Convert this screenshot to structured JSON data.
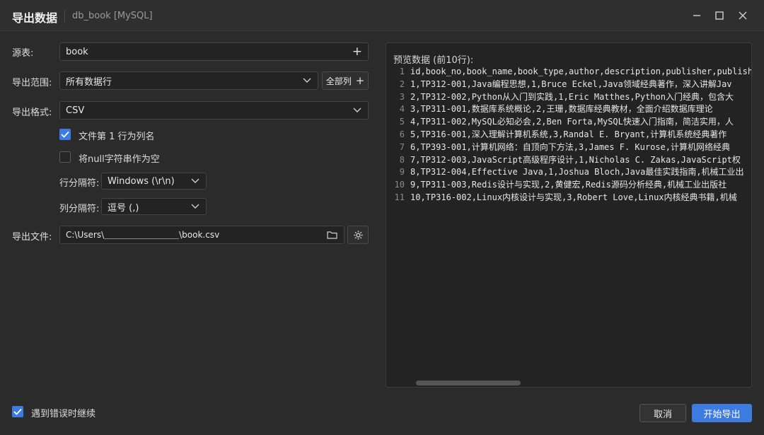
{
  "window": {
    "title": "导出数据",
    "subtitle": "db_book [MySQL]"
  },
  "form": {
    "source_table": {
      "label": "源表:",
      "value": "book"
    },
    "export_range": {
      "label": "导出范围:",
      "value": "所有数据行",
      "columns_button": "全部列"
    },
    "export_format": {
      "label": "导出格式:",
      "value": "CSV"
    },
    "first_row_header": {
      "label": "文件第 1 行为列名",
      "checked": true
    },
    "null_as_empty": {
      "label": "将null字符串作为空",
      "checked": false
    },
    "row_separator": {
      "label": "行分隔符:",
      "value": "Windows (\\r\\n)"
    },
    "column_separator": {
      "label": "列分隔符:",
      "value": "逗号 (,)"
    },
    "export_file": {
      "label": "导出文件:",
      "path_prefix": "C:\\Users\\",
      "path_suffix": "\\book.csv"
    }
  },
  "preview": {
    "title": "预览数据 (前10行):",
    "lines": [
      {
        "n": "1",
        "text": "id,book_no,book_name,book_type,author,description,publisher,publish"
      },
      {
        "n": "2",
        "text": "1,TP312-001,Java编程思想,1,Bruce Eckel,Java领域经典著作，深入讲解Jav"
      },
      {
        "n": "3",
        "text": "2,TP312-002,Python从入门到实践,1,Eric Matthes,Python入门经典，包含大"
      },
      {
        "n": "4",
        "text": "3,TP311-001,数据库系统概论,2,王珊,数据库经典教材，全面介绍数据库理论"
      },
      {
        "n": "5",
        "text": "4,TP311-002,MySQL必知必会,2,Ben Forta,MySQL快速入门指南，简洁实用，人"
      },
      {
        "n": "6",
        "text": "5,TP316-001,深入理解计算机系统,3,Randal E. Bryant,计算机系统经典著作"
      },
      {
        "n": "7",
        "text": "6,TP393-001,计算机网络：自顶向下方法,3,James F. Kurose,计算机网络经典"
      },
      {
        "n": "8",
        "text": "7,TP312-003,JavaScript高级程序设计,1,Nicholas C. Zakas,JavaScript权"
      },
      {
        "n": "9",
        "text": "8,TP312-004,Effective Java,1,Joshua Bloch,Java最佳实践指南,机械工业出"
      },
      {
        "n": "10",
        "text": "9,TP311-003,Redis设计与实现,2,黄健宏,Redis源码分析经典,机械工业出版社"
      },
      {
        "n": "11",
        "text": "10,TP316-002,Linux内核设计与实现,3,Robert Love,Linux内核经典书籍,机械"
      }
    ]
  },
  "footer": {
    "continue_on_error": {
      "label": "遇到错误时继续",
      "checked": true
    },
    "cancel": "取消",
    "start_export": "开始导出"
  },
  "colors": {
    "accent": "#3d7be0",
    "background": "#2b2b2b",
    "field": "#232323"
  }
}
